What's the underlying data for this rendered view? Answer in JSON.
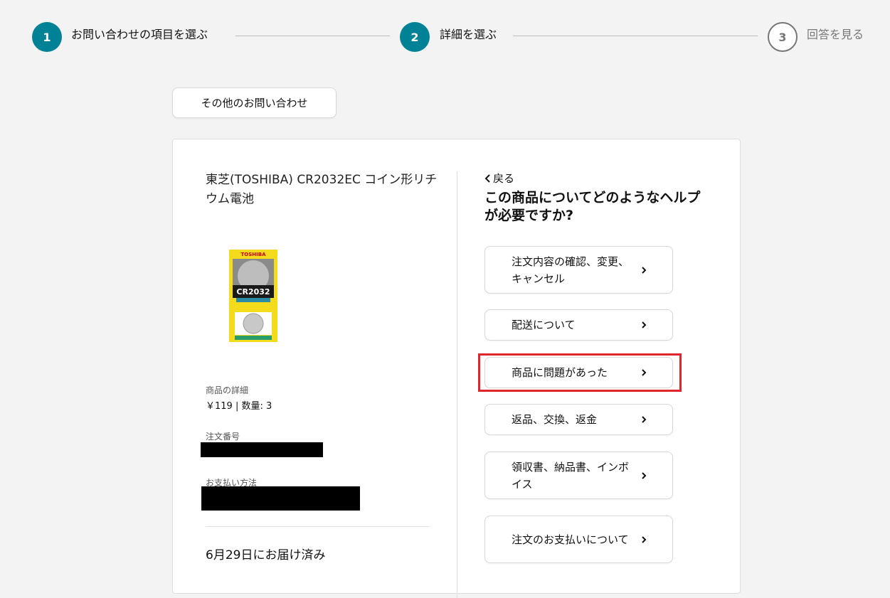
{
  "stepper": {
    "steps": [
      {
        "number": "1",
        "label": "お問い合わせの項目を選ぶ"
      },
      {
        "number": "2",
        "label": "詳細を選ぶ"
      },
      {
        "number": "3",
        "label": "回答を見る"
      }
    ]
  },
  "other_inquiry_label": "その他のお問い合わせ",
  "product": {
    "title": "東芝(TOSHIBA) CR2032EC コイン形リチウム電池",
    "image_brand": "TOSHIBA",
    "image_model": "CR2032",
    "details_label": "商品の詳細",
    "details_value": "￥119 | 数量: 3",
    "order_number_label": "注文番号",
    "payment_method_label": "お支払い方法",
    "delivery_status": "6月29日にお届け済み"
  },
  "help": {
    "back_label": "戻る",
    "question": "この商品についてどのようなヘルプが必要ですか?",
    "options": [
      {
        "label": "注文内容の確認、変更、キャンセル"
      },
      {
        "label": "配送について"
      },
      {
        "label": "商品に問題があった"
      },
      {
        "label": "返品、交換、返金"
      },
      {
        "label": "領収書、納品書、インボイス"
      },
      {
        "label": "注文のお支払いについて"
      }
    ]
  },
  "colors": {
    "accent": "#008296",
    "highlight": "#e0252d"
  }
}
